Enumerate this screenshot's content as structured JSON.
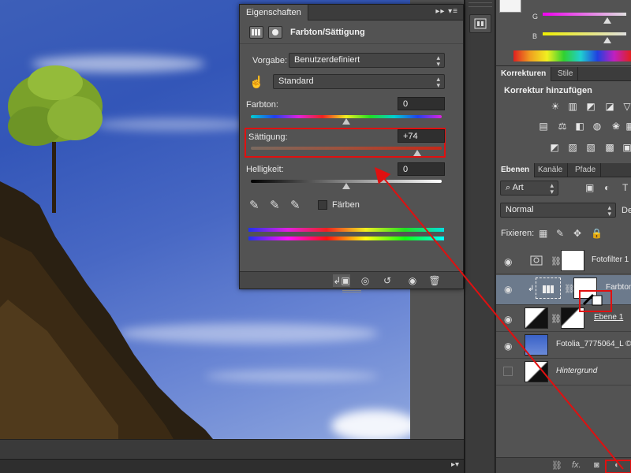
{
  "properties_panel": {
    "tab_title": "Eigenschaften",
    "tab_controls": "▸▸ ▾≡",
    "header_title": "Farbton/Sättigung",
    "vorgabe_label": "Vorgabe:",
    "vorgabe_value": "Benutzerdefiniert",
    "channel_value": "Standard",
    "farbton_label": "Farbton:",
    "farbton_value": "0",
    "saettigung_label": "Sättigung:",
    "saettigung_value": "+74",
    "helligkeit_label": "Helligkeit:",
    "helligkeit_value": "0",
    "faerben_label": "Färben",
    "faerben_checked": false,
    "farbton_level": 0,
    "saettigung_level": 74,
    "helligkeit_level": 0
  },
  "color_panel": {
    "channels": [
      "G",
      "B"
    ]
  },
  "adjustments_panel": {
    "tabs": [
      "Korrekturen",
      "Stile"
    ],
    "title": "Korrektur hinzufügen"
  },
  "layers_panel": {
    "tabs": [
      "Ebenen",
      "Kanäle",
      "Pfade"
    ],
    "filter_value": "Art",
    "blend_mode": "Normal",
    "opacity_label_partial": "De",
    "fixieren_label": "Fixieren:",
    "layers": [
      {
        "name": "Fotofilter 1",
        "visible": true,
        "selected": false
      },
      {
        "name": "Farbton/",
        "visible": true,
        "selected": true
      },
      {
        "name": "Ebene 1",
        "visible": true,
        "selected": false
      },
      {
        "name": "Fotolia_7775064_L © T",
        "visible": true,
        "selected": false
      },
      {
        "name": "Hintergrund",
        "visible": false,
        "selected": false
      }
    ],
    "footer_fx": "fx."
  },
  "colors": {
    "highlight_red": "#e01010",
    "panel_bg": "#535353",
    "selected_row": "#6c7a8c"
  }
}
